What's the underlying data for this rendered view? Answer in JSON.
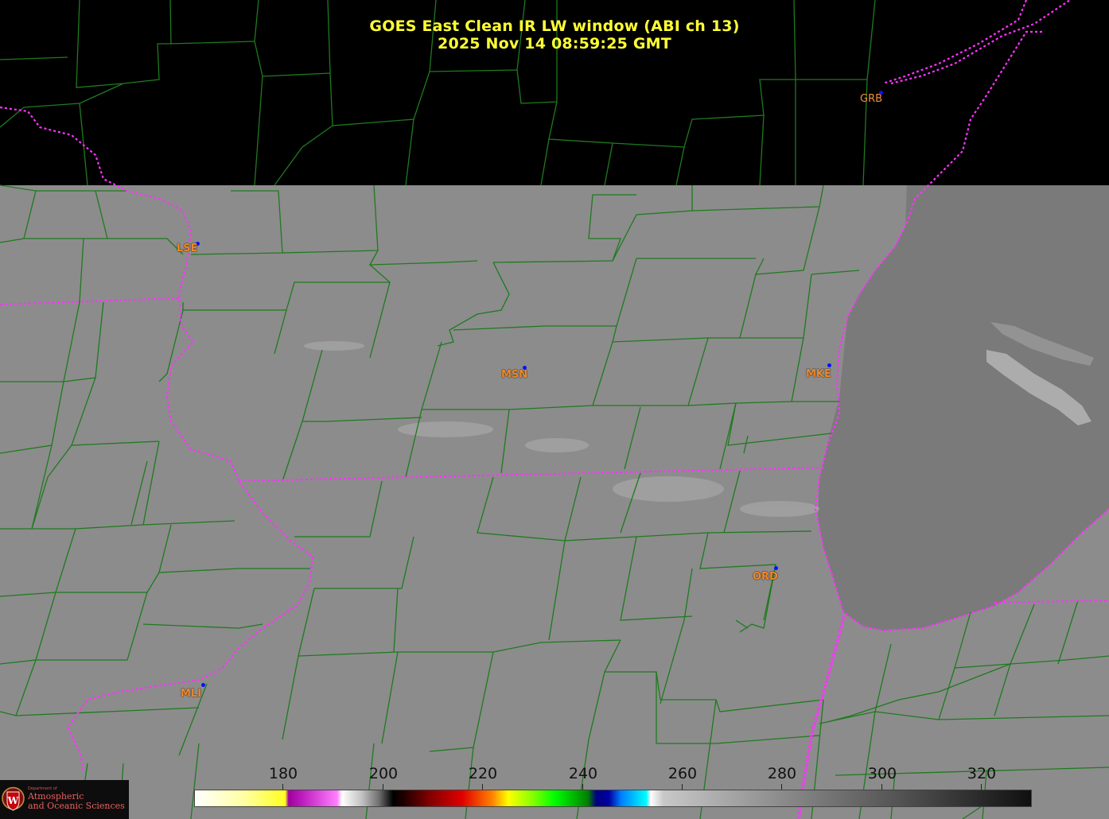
{
  "title": {
    "line1": "GOES East Clean IR LW window (ABI ch 13)",
    "line2": "2025 Nov 14  08:59:25 GMT"
  },
  "stations": [
    {
      "code": "GRB"
    },
    {
      "code": "LSE"
    },
    {
      "code": "MSN"
    },
    {
      "code": "MKE"
    },
    {
      "code": "ORD"
    },
    {
      "code": "MLI"
    }
  ],
  "colorbar": {
    "tick_labels": [
      "180",
      "200",
      "220",
      "240",
      "260",
      "280",
      "300",
      "320"
    ]
  },
  "logo": {
    "small_text": "Department of",
    "line1": "Atmospheric",
    "line2": "and Oceanic Sciences"
  },
  "colors": {
    "title": "#ffff33",
    "county_lines": "#1f7a1f",
    "state_lines": "#ff33ff",
    "station_label": "#f08a2a",
    "station_dot": "#0a10ff",
    "land_gray": "#8c8c8c",
    "lake_gray": "#7a7a7a"
  }
}
